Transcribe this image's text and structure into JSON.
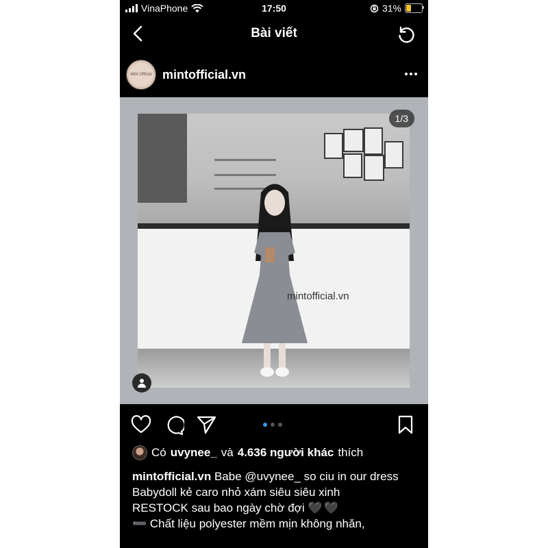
{
  "status_bar": {
    "carrier": "VinaPhone",
    "time": "17:50",
    "battery": "31%",
    "battery_level": 0.31
  },
  "nav": {
    "title": "Bài viết"
  },
  "post": {
    "username": "mintofficial.vn",
    "avatar_text": "Mint Official",
    "image_counter": "1/3",
    "watermark": "mintofficial.vn",
    "carousel_total": 3,
    "carousel_active_index": 1
  },
  "likes": {
    "prefix": "Có",
    "user": "uvynee_",
    "conj": "và",
    "others": "4.636 người khác",
    "suffix": "thích"
  },
  "caption": {
    "username": "mintofficial.vn",
    "first_line": "Babe @uvynee_ so ciu in our dress",
    "line2": "Babydoll kẻ caro nhỏ xám siêu siêu xinh",
    "line3": "RESTOCK sau bao ngày chờ đợi",
    "line3_emoji": "🖤🖤",
    "line4": "➖ Chất liệu polyester mềm mịn không nhăn,"
  },
  "colors": {
    "background": "#000000",
    "photo_frame": "#b0b3b8",
    "carousel_active": "#3897f0"
  }
}
